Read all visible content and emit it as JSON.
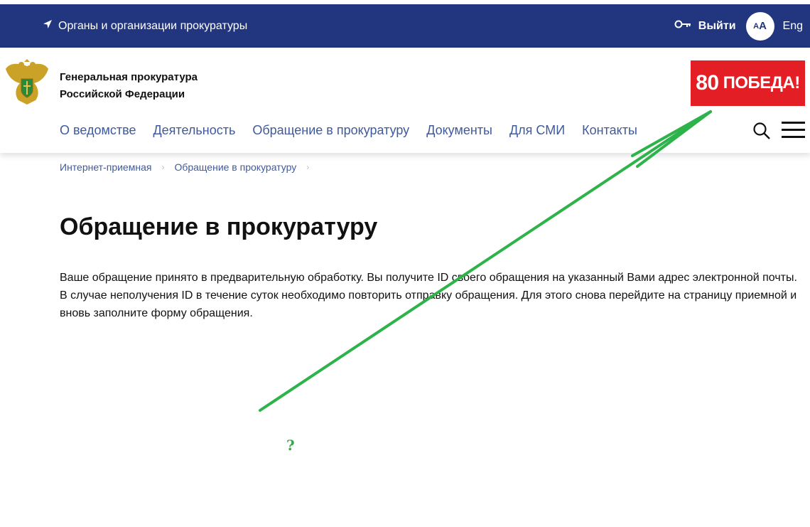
{
  "topbar": {
    "organizations_label": "Органы и организации прокуратуры",
    "logout_label": "Выйти",
    "font_toggle_small": "A",
    "font_toggle_big": "A",
    "language_label": "Eng",
    "bg_color": "#21367f"
  },
  "header": {
    "org_name_line1": "Генеральная прокуратура",
    "org_name_line2": "Российской Федерации",
    "banner_number": "80",
    "banner_text": "ПОБЕДА!",
    "banner_color": "#e31e24"
  },
  "nav": {
    "items": [
      {
        "label": "О ведомстве"
      },
      {
        "label": "Деятельность"
      },
      {
        "label": "Обращение в прокуратуру"
      },
      {
        "label": "Документы"
      },
      {
        "label": "Для СМИ"
      },
      {
        "label": "Контакты"
      }
    ]
  },
  "breadcrumbs": [
    {
      "label": "Интернет-приемная"
    },
    {
      "label": "Обращение в прокуратуру"
    }
  ],
  "main": {
    "title": "Обращение в прокуратуру",
    "message_line1": "Ваше обращение принято в предварительную обработку. Вы получите ID своего обращения на указанный Вами адрес электронной почты.",
    "message_line2": "В случае неполучения ID в течение суток необходимо повторить отправку обращения. Для этого снова перейдите на страницу приемной и",
    "message_line3": "вновь заполните форму обращения."
  },
  "annotation": {
    "question_mark": "?",
    "color": "#3aa64b"
  }
}
